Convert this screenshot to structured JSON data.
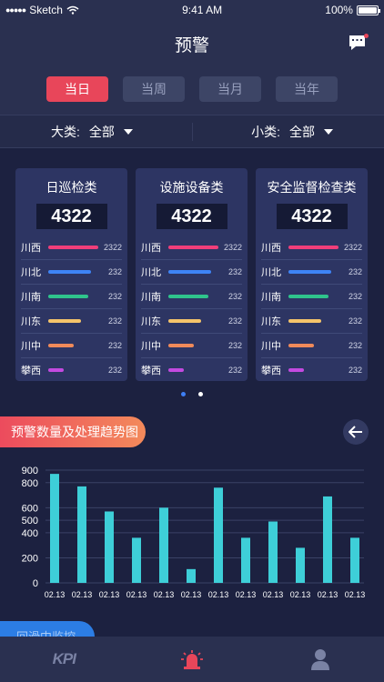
{
  "status_bar": {
    "carrier": "Sketch",
    "time": "9:41 AM",
    "battery": "100%",
    "battery_level": 1.0
  },
  "header": {
    "title": "预警",
    "icon": "message-icon"
  },
  "tabs": [
    {
      "label": "当日",
      "active": true
    },
    {
      "label": "当周",
      "active": false
    },
    {
      "label": "当月",
      "active": false
    },
    {
      "label": "当年",
      "active": false
    }
  ],
  "filters": {
    "major": {
      "label": "大类:",
      "value": "全部"
    },
    "minor": {
      "label": "小类:",
      "value": "全部"
    }
  },
  "cards": [
    {
      "title": "日巡检类",
      "total": "4322",
      "rows": [
        {
          "name": "川西",
          "value": "2322"
        },
        {
          "name": "川北",
          "value": "232"
        },
        {
          "name": "川南",
          "value": "232"
        },
        {
          "name": "川东",
          "value": "232"
        },
        {
          "name": "川中",
          "value": "232"
        },
        {
          "name": "攀西",
          "value": "232"
        }
      ]
    },
    {
      "title": "设施设备类",
      "total": "4322",
      "rows": [
        {
          "name": "川西",
          "value": "2322"
        },
        {
          "name": "川北",
          "value": "232"
        },
        {
          "name": "川南",
          "value": "232"
        },
        {
          "name": "川东",
          "value": "232"
        },
        {
          "name": "川中",
          "value": "232"
        },
        {
          "name": "攀西",
          "value": "232"
        }
      ]
    },
    {
      "title": "安全监督检查类",
      "total": "4322",
      "rows": [
        {
          "name": "川西",
          "value": "2322"
        },
        {
          "name": "川北",
          "value": "232"
        },
        {
          "name": "川南",
          "value": "232"
        },
        {
          "name": "川东",
          "value": "232"
        },
        {
          "name": "川中",
          "value": "232"
        },
        {
          "name": "攀西",
          "value": "232"
        }
      ]
    }
  ],
  "region_colors": [
    "#f03e7a",
    "#3e84f5",
    "#2fc48c",
    "#f5c46a",
    "#f08a5a",
    "#c34ae0"
  ],
  "region_bar_fraction": [
    1.0,
    0.85,
    0.8,
    0.65,
    0.5,
    0.3
  ],
  "pager": {
    "count": 2,
    "active": 0
  },
  "trend_section": {
    "title": "预警数量及处理趋势图",
    "back_icon": "arrow-left-icon"
  },
  "chart_data": {
    "type": "bar",
    "categories": [
      "02.13",
      "02.13",
      "02.13",
      "02.13",
      "02.13",
      "02.13",
      "02.13",
      "02.13",
      "02.13",
      "02.13",
      "02.13",
      "02.13"
    ],
    "values": [
      870,
      770,
      570,
      360,
      600,
      110,
      760,
      360,
      490,
      280,
      690,
      360
    ],
    "ylim": [
      0,
      900
    ],
    "yticks": [
      0,
      200,
      400,
      500,
      600,
      800,
      900
    ],
    "ytick_labels": [
      "0",
      "200",
      "400",
      "500",
      "600",
      "800",
      "900"
    ],
    "grid": true,
    "bar_color": "#3ecfd8"
  },
  "next_section": {
    "title": "回滑中监控"
  },
  "tabbar": [
    {
      "label": "KPI",
      "icon": "kpi-icon"
    },
    {
      "icon": "alarm-icon",
      "active": true
    },
    {
      "icon": "user-icon"
    }
  ]
}
